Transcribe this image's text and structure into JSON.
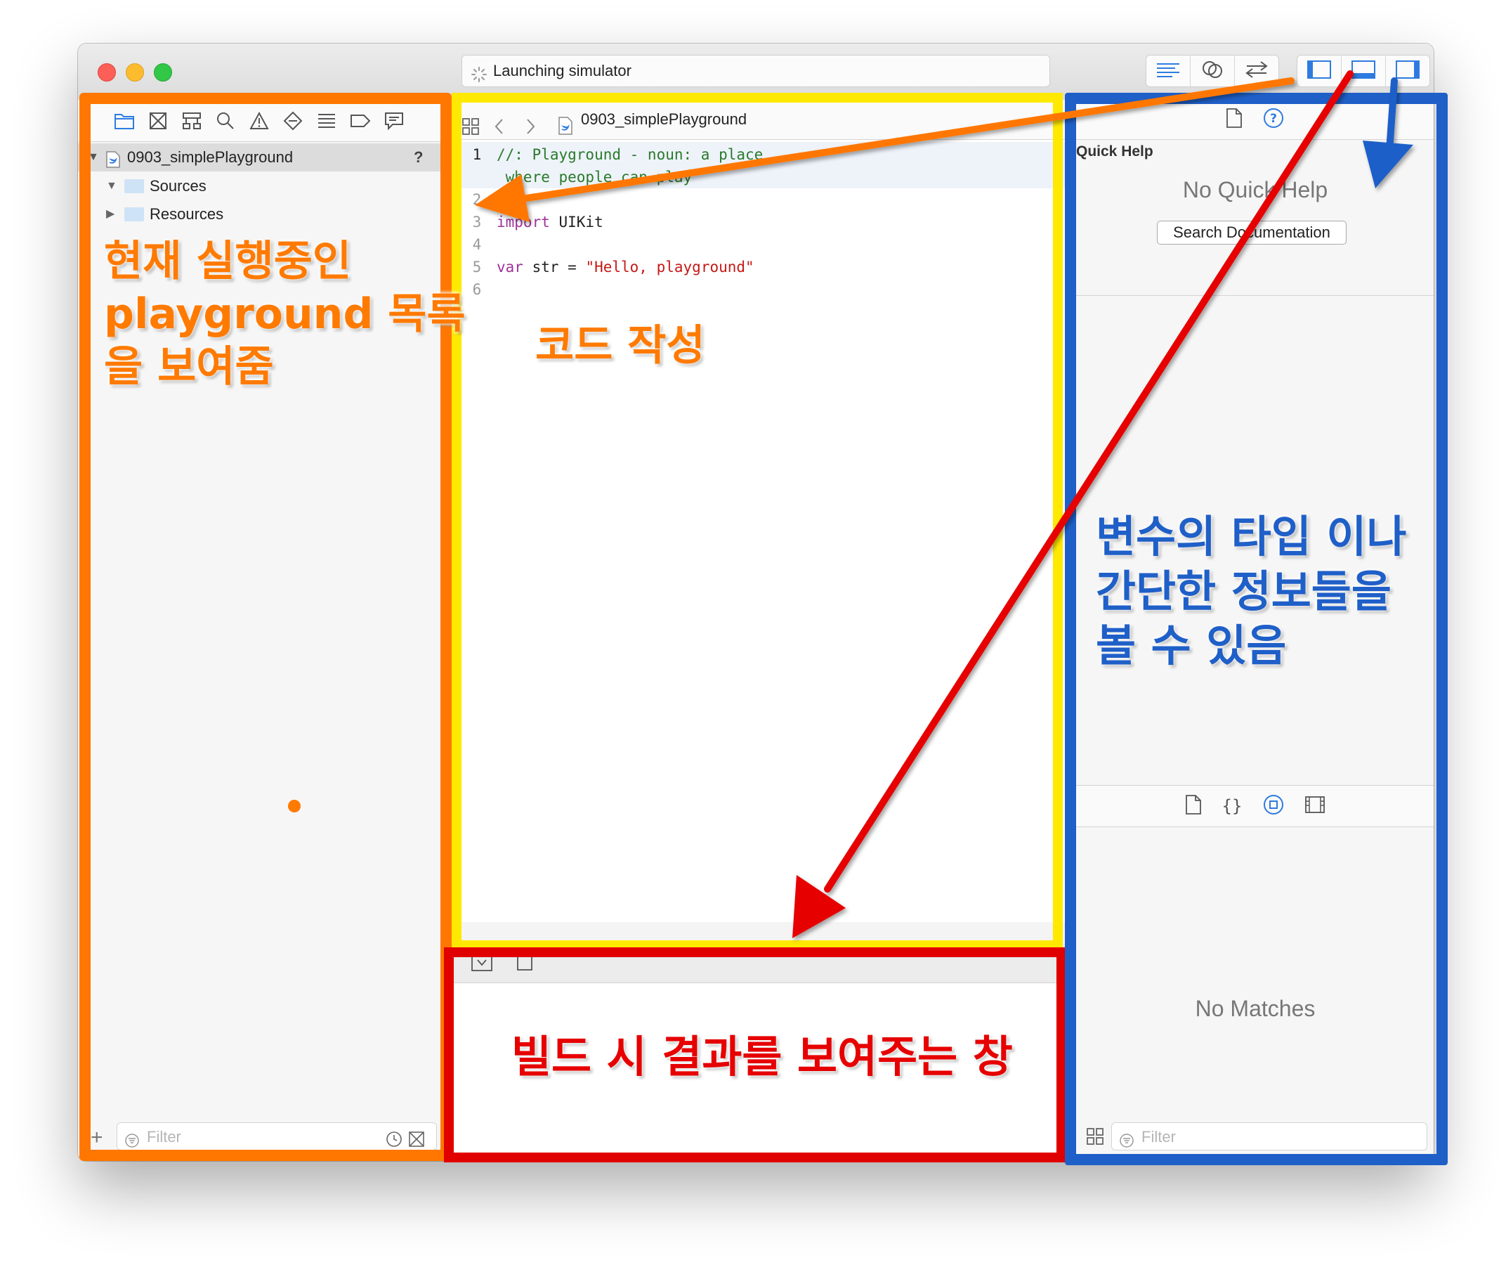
{
  "window": {
    "status_text": "Launching simulator"
  },
  "navigator": {
    "project_name": "0903_simplePlayground",
    "project_badge": "?",
    "items": [
      {
        "label": "Sources"
      },
      {
        "label": "Resources"
      }
    ],
    "filter_placeholder": "Filter"
  },
  "editor": {
    "file_name": "0903_simplePlayground",
    "lines": [
      {
        "num": "1",
        "text": "//: Playground - noun: a place"
      },
      {
        "num": "",
        "text": "    where people can play"
      },
      {
        "num": "2",
        "text": ""
      },
      {
        "num": "3",
        "kw": "import",
        "rest": " UIKit"
      },
      {
        "num": "4",
        "text": ""
      },
      {
        "num": "5",
        "kw": "var",
        "mid": " str = ",
        "str": "\"Hello, playground\""
      },
      {
        "num": "6",
        "text": ""
      }
    ]
  },
  "inspector": {
    "quick_help_title": "Quick Help",
    "no_quick_help": "No Quick Help",
    "search_button": "Search Documentation",
    "no_matches": "No Matches",
    "filter_placeholder": "Filter"
  },
  "annotations": {
    "navigator_label": [
      "현재 실행중인",
      "playground 목록",
      "을 보여줌"
    ],
    "editor_label": "코드 작성",
    "debug_label": "빌드 시 결과를 보여주는 창",
    "inspector_label": [
      "변수의 타입 이나",
      "간단한 정보들을",
      "볼 수 있음"
    ]
  },
  "colors": {
    "navigator_box": "#ff7700",
    "editor_box": "#ffe900",
    "debug_box": "#e10000",
    "inspector_box": "#1f5fc8",
    "orange_text": "#ff7a00",
    "red_text": "#e60000",
    "blue_text": "#1f5fc8",
    "accent_blue": "#2e7be0",
    "comment_green": "#2a7a2a",
    "keyword_purple": "#a0329c",
    "string_red": "#c41a16"
  }
}
